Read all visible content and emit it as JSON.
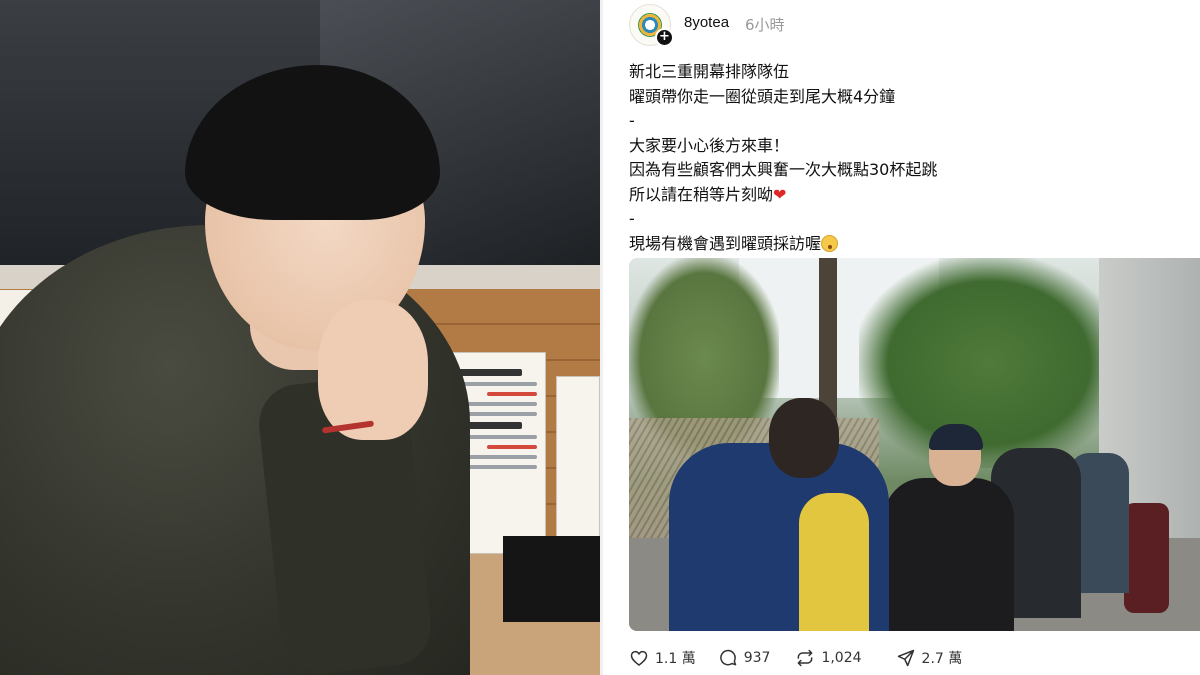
{
  "post": {
    "username": "8yotea",
    "time_ago": "6小時",
    "lines": [
      "新北三重開幕排隊隊伍",
      "曜頭帶你走一圈從頭走到尾大概4分鐘",
      "-",
      "大家要小心後方來車！",
      "因為有些顧客們太興奮一次大概點30杯起跳",
      "所以請在稍等片刻呦",
      "-",
      "現場有機會遇到曜頭採訪喔"
    ],
    "heart_emoji": "❤"
  },
  "actions": {
    "likes": "1.1 萬",
    "comments": "937",
    "reposts": "1,024",
    "shares": "2.7 萬"
  },
  "icons": {
    "like": "heart-icon",
    "comment": "comment-bubble-icon",
    "repost": "repost-icon",
    "share": "send-icon",
    "follow": "plus-icon"
  },
  "colors": {
    "heart": "#e02727",
    "time": "#999999"
  }
}
